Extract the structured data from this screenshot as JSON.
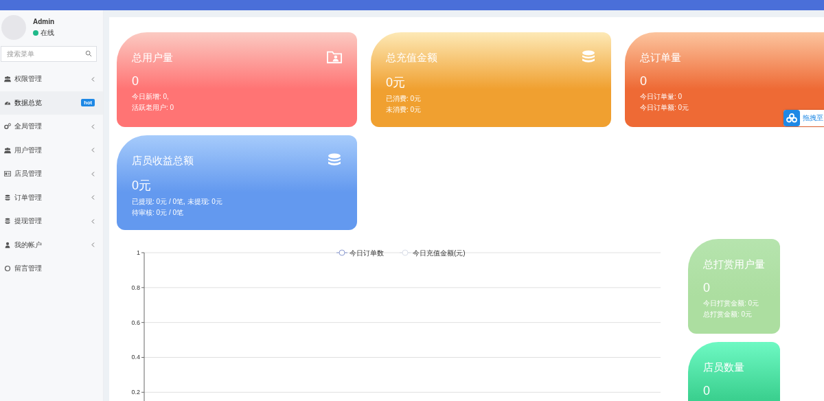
{
  "sidebar": {
    "user": {
      "name": "Admin",
      "status": "在线"
    },
    "search": {
      "placeholder": "搜索菜单"
    },
    "items": [
      {
        "label": "权限管理",
        "kind": "users",
        "selected": false,
        "submenu": true
      },
      {
        "label": "数据总览",
        "kind": "dashboard",
        "selected": true,
        "submenu": false,
        "badge": "hot"
      },
      {
        "label": "全局管理",
        "kind": "gears",
        "selected": false,
        "submenu": true
      },
      {
        "label": "用户管理",
        "kind": "users",
        "selected": false,
        "submenu": true
      },
      {
        "label": "店员管理",
        "kind": "idcard",
        "selected": false,
        "submenu": true
      },
      {
        "label": "订单管理",
        "kind": "database",
        "selected": false,
        "submenu": true
      },
      {
        "label": "提现管理",
        "kind": "database",
        "selected": false,
        "submenu": true
      },
      {
        "label": "我的帐户",
        "kind": "user",
        "selected": false,
        "submenu": true
      },
      {
        "label": "留言管理",
        "kind": "circle",
        "selected": false,
        "submenu": false
      }
    ]
  },
  "cards": [
    {
      "title": "总用户量",
      "value": "0",
      "lines": [
        "今日新增: 0,",
        "活跃老用户: 0"
      ],
      "kind": "folder",
      "color": "#ff7474"
    },
    {
      "title": "总充值金额",
      "value": "0元",
      "lines": [
        "已消费: 0元",
        "未消费: 0元"
      ],
      "kind": "stack",
      "color": "#f0a030"
    },
    {
      "title": "总订单量",
      "value": "0",
      "lines": [
        "今日订单量: 0",
        "今日订单额: 0元"
      ],
      "kind": "plain",
      "color": "#ee6a35"
    },
    {
      "title": "店员收益总额",
      "value": "0元",
      "lines": [
        "已提现: 0元 / 0笔, 未提现: 0元",
        "待审核: 0元 / 0笔"
      ],
      "kind": "stack",
      "color": "#6399ef"
    }
  ],
  "chart": {
    "chart_data": {
      "type": "line",
      "ylim": [
        0.15,
        1
      ],
      "yticks": [
        0.2,
        0.4,
        0.6,
        0.8,
        1
      ],
      "grid": true,
      "series": [
        {
          "name": "今日订单数",
          "color": "#8c9bd1"
        },
        {
          "name": "今日充值金额(元)",
          "color": "#d9dee8"
        }
      ]
    }
  },
  "side_cards": [
    {
      "title": "总打赏用户量",
      "value": "0",
      "lines": [
        "今日打赏金额: 0元",
        "总打赏金额: 0元"
      ],
      "color": "#acdea0"
    },
    {
      "title": "店员数量",
      "value": "0",
      "color": "#3bd08f"
    }
  ],
  "drag_widget": {
    "label": "拖拽至"
  }
}
